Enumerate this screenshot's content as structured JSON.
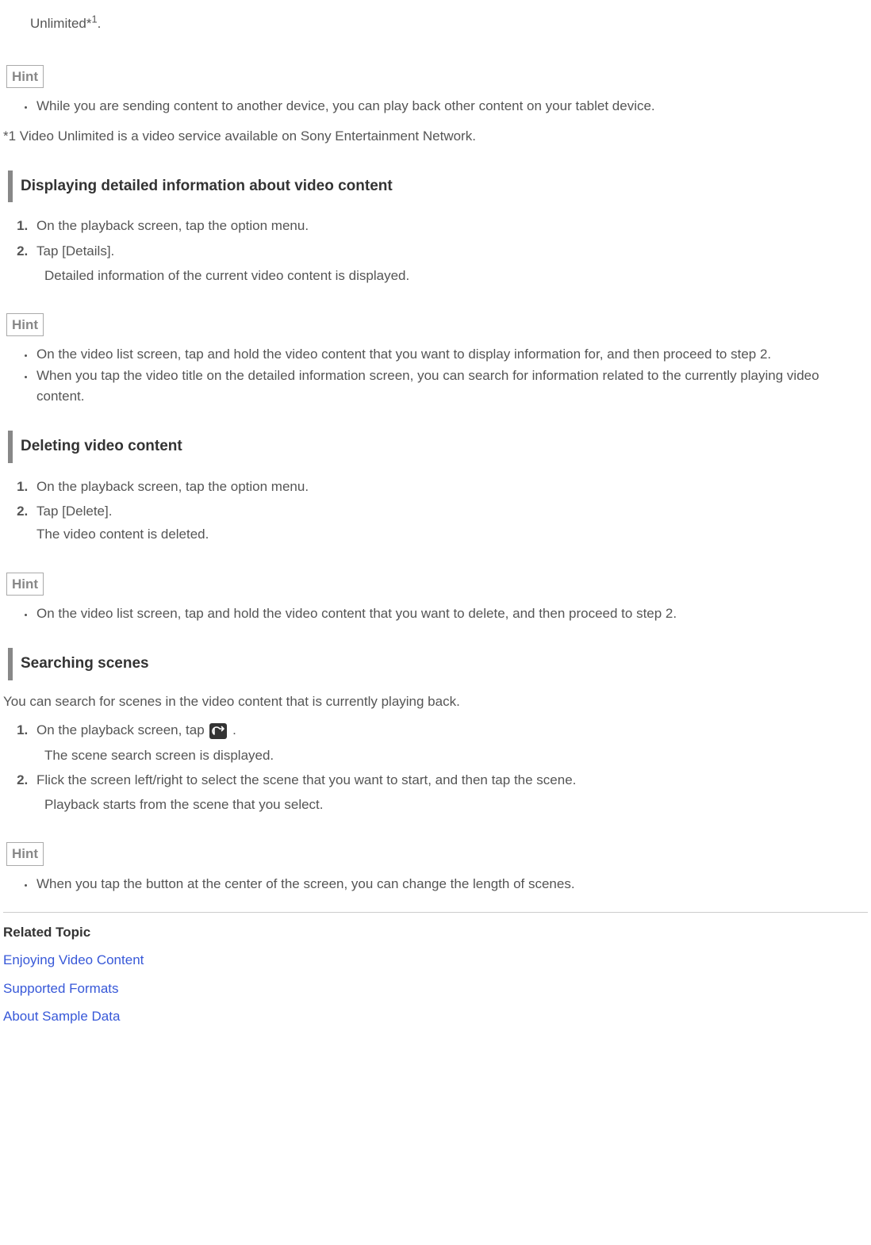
{
  "intro_fragment": {
    "prefix": "Unlimited*",
    "sup": "1",
    "suffix": "."
  },
  "hint_label": "Hint",
  "hint1_items": [
    "While you are sending content to another device, you can play back other content on your tablet device."
  ],
  "footnote1": "*1 Video Unlimited is a video service available on Sony Entertainment Network.",
  "section1": {
    "heading": "Displaying detailed information about video content",
    "steps": [
      {
        "text": "On the playback screen, tap the option menu."
      },
      {
        "text": "Tap [Details].",
        "sub_indent": "Detailed information of the current video content is displayed."
      }
    ],
    "hint_items": [
      "On the video list screen, tap and hold the video content that you want to display information for, and then proceed to step 2.",
      "When you tap the video title on the detailed information screen, you can search for information related to the currently playing video content."
    ]
  },
  "section2": {
    "heading": "Deleting video content",
    "steps": [
      {
        "text": "On the playback screen, tap the option menu."
      },
      {
        "text": "Tap [Delete].",
        "sub_plain": "The video content is deleted."
      }
    ],
    "hint_items": [
      "On the video list screen, tap and hold the video content that you want to delete, and then proceed to step 2."
    ]
  },
  "section3": {
    "heading": "Searching scenes",
    "intro": "You can search for scenes in the video content that is currently playing back.",
    "steps": [
      {
        "before_icon": "On the playback screen, tap ",
        "after_icon": " .",
        "sub_indent": "The scene search screen is displayed."
      },
      {
        "text": "Flick the screen left/right to select the scene that you want to start, and then tap the scene.",
        "sub_indent": "Playback starts from the scene that you select."
      }
    ],
    "hint_items": [
      "When you tap the button at the center of the screen, you can change the length of scenes."
    ]
  },
  "related": {
    "label": "Related Topic",
    "links": [
      "Enjoying Video Content",
      "Supported Formats",
      "About Sample Data"
    ]
  }
}
